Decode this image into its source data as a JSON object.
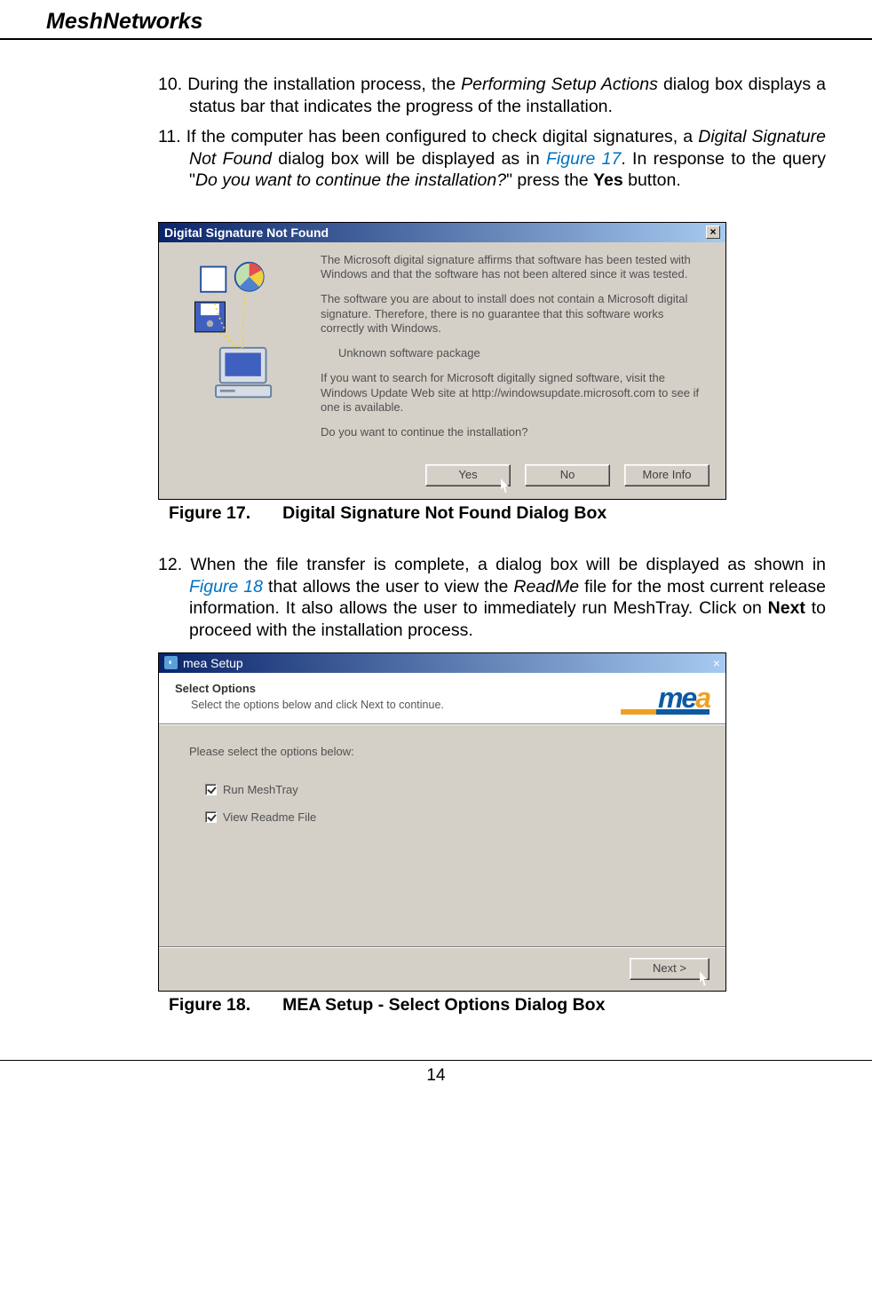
{
  "header": {
    "title": "MeshNetworks"
  },
  "step10": {
    "num": "10.",
    "t1": "During the installation process, the ",
    "i1": "Performing Setup Actions",
    "t2": " dialog box displays a status bar that indicates the progress of the installation."
  },
  "step11": {
    "num": "11.",
    "t1": "If the computer has been configured to check digital signatures, a ",
    "i1": "Digital Signature Not Found",
    "t2": " dialog box will be displayed as in ",
    "link": "Figure 17",
    "t3": ".  In response to the query \"",
    "q": "Do you want to continue the installation?",
    "t4": "\" press the ",
    "b": "Yes",
    "t5": " button."
  },
  "dlg1": {
    "title": "Digital Signature Not Found",
    "p1": "The Microsoft digital signature affirms that software has been tested with Windows and that the software has not been altered since it was tested.",
    "p2": "The software you are about to install does not contain a Microsoft digital signature. Therefore, there is no guarantee that this software works correctly with Windows.",
    "pkg": "Unknown software package",
    "p3": "If you want to search for Microsoft digitally signed software, visit the Windows Update Web site at http://windowsupdate.microsoft.com to see if one is available.",
    "p4": "Do you want to continue the installation?",
    "btn_yes": "Yes",
    "btn_no": "No",
    "btn_more": "More Info"
  },
  "fig17": {
    "num": "Figure 17.",
    "title": "Digital Signature Not Found Dialog Box"
  },
  "step12": {
    "num": "12.",
    "t1": "When the file transfer is complete, a dialog box will be displayed as shown in ",
    "link": "Figure 18",
    "t2": " that allows the user to view the ",
    "i1": "ReadMe",
    "t3": " file for the most current release information.  It also allows the user to immediately run MeshTray.  Click on ",
    "b": "Next",
    "t4": " to proceed with the installation process."
  },
  "dlg2": {
    "title": "mea Setup",
    "h_title": "Select Options",
    "h_sub": "Select the options below and click Next to continue.",
    "logo": "mea",
    "prompt": "Please select the options below:",
    "opt1": "Run MeshTray",
    "opt2": "View Readme File",
    "btn_next": "Next >"
  },
  "fig18": {
    "num": "Figure 18.",
    "title": "MEA Setup - Select Options Dialog Box"
  },
  "footer": {
    "page": "14"
  }
}
